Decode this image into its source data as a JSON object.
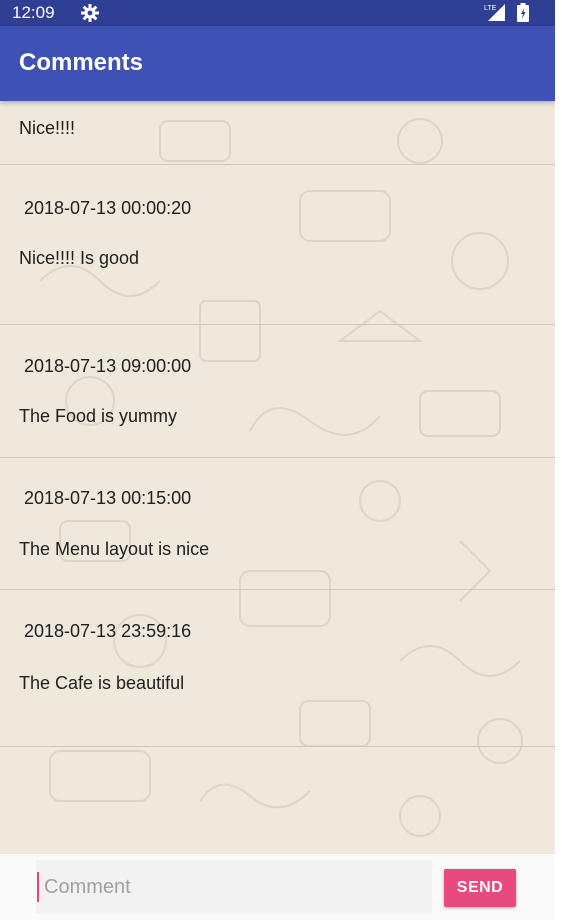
{
  "status_bar": {
    "time": "12:09",
    "network": "LTE",
    "background": "#2f3f94"
  },
  "app_bar": {
    "title": "Comments",
    "color": "#3e51b4"
  },
  "comments": {
    "first_text": "Nice!!!!",
    "items": [
      {
        "date": "2018-07-13 00:00:20",
        "text": "Nice!!!! Is good"
      },
      {
        "date": "2018-07-13 09:00:00",
        "text": "The Food is yummy"
      },
      {
        "date": "2018-07-13 00:15:00",
        "text": "The Menu layout is nice"
      },
      {
        "date": "2018-07-13 23:59:16",
        "text": "The Cafe is beautiful"
      }
    ]
  },
  "input_bar": {
    "placeholder": "Comment",
    "value": "",
    "send_label": "SEND",
    "accent": "#e8497f"
  },
  "icons": [
    "gear-icon",
    "lte-signal-icon",
    "battery-charging-icon"
  ]
}
